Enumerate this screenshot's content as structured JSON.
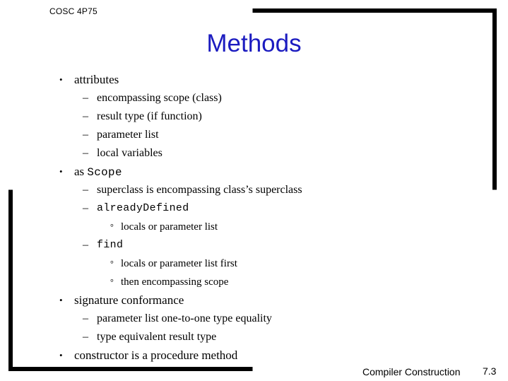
{
  "header": {
    "course_code": "COSC 4P75"
  },
  "title": {
    "text": "Methods",
    "color": "#1c1cc0"
  },
  "footer": {
    "label": "Compiler Construction",
    "page_number": "7.3"
  },
  "bullets": {
    "marks": {
      "level1": "•",
      "level2": "–",
      "level3": "°"
    }
  },
  "outline": [
    {
      "level": 1,
      "text": "attributes"
    },
    {
      "level": 2,
      "text": "encompassing scope (class)"
    },
    {
      "level": 2,
      "text": "result type (if function)"
    },
    {
      "level": 2,
      "text": "parameter list"
    },
    {
      "level": 2,
      "text": "local variables"
    },
    {
      "level": 1,
      "text_plain": "as ",
      "text_code": "Scope"
    },
    {
      "level": 2,
      "text": "superclass is encompassing class’s superclass"
    },
    {
      "level": 2,
      "text_code": "alreadyDefined"
    },
    {
      "level": 3,
      "text": "locals or parameter list"
    },
    {
      "level": 2,
      "text_code": "find"
    },
    {
      "level": 3,
      "text": "locals or parameter list first"
    },
    {
      "level": 3,
      "text": "then encompassing scope"
    },
    {
      "level": 1,
      "text": "signature conformance"
    },
    {
      "level": 2,
      "text": "parameter list one-to-one type equality"
    },
    {
      "level": 2,
      "text": "type equivalent result type"
    },
    {
      "level": 1,
      "text": "constructor is a procedure method"
    }
  ]
}
